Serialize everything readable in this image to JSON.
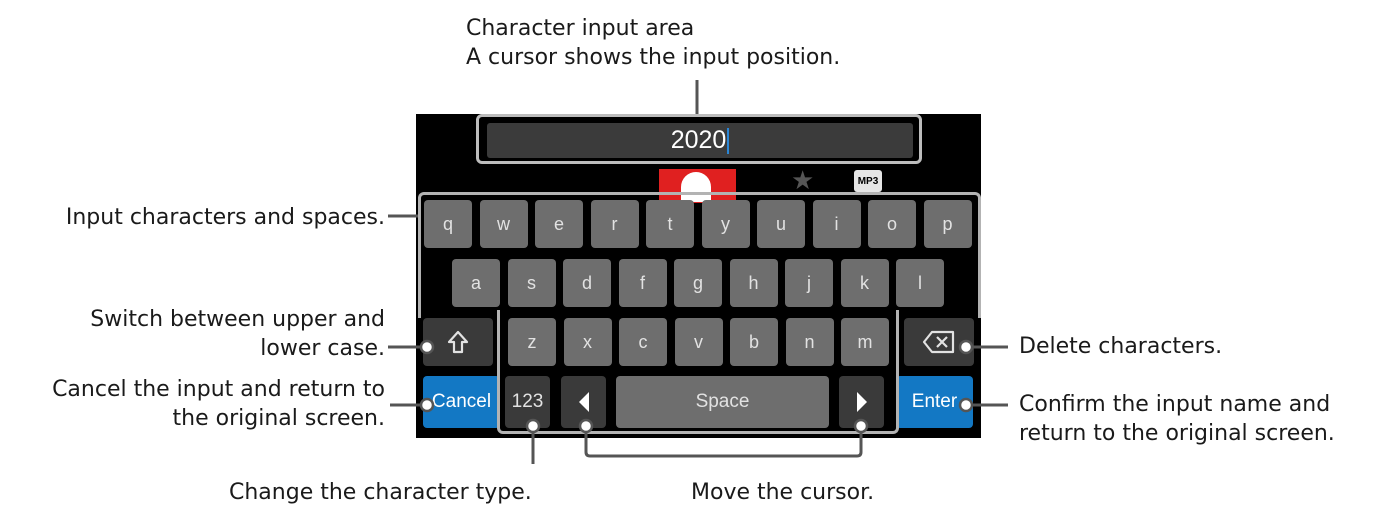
{
  "callouts": {
    "input_area_title": "Character input area",
    "input_area_desc": "A cursor shows the input position.",
    "characters": "Input characters and spaces.",
    "shift_line1": "Switch between upper and",
    "shift_line2": "lower case.",
    "cancel_line1": "Cancel the input and return to",
    "cancel_line2": "the original screen.",
    "type": "Change the character type.",
    "cursor_move": "Move the cursor.",
    "delete": "Delete characters.",
    "enter_line1": "Confirm the input name and",
    "enter_line2": "return to the original screen."
  },
  "screen": {
    "input_value": "2020",
    "mp3_label": "MP3",
    "row1": [
      "q",
      "w",
      "e",
      "r",
      "t",
      "y",
      "u",
      "i",
      "o",
      "p"
    ],
    "row2": [
      "a",
      "s",
      "d",
      "f",
      "g",
      "h",
      "j",
      "k",
      "l"
    ],
    "row3": [
      "z",
      "x",
      "c",
      "v",
      "b",
      "n",
      "m"
    ],
    "shift_icon": "shift-arrow-icon",
    "backspace_icon": "backspace-icon",
    "cancel_label": "Cancel",
    "num_label": "123",
    "space_label": "Space",
    "enter_label": "Enter",
    "accent_color": "#1378c4"
  }
}
